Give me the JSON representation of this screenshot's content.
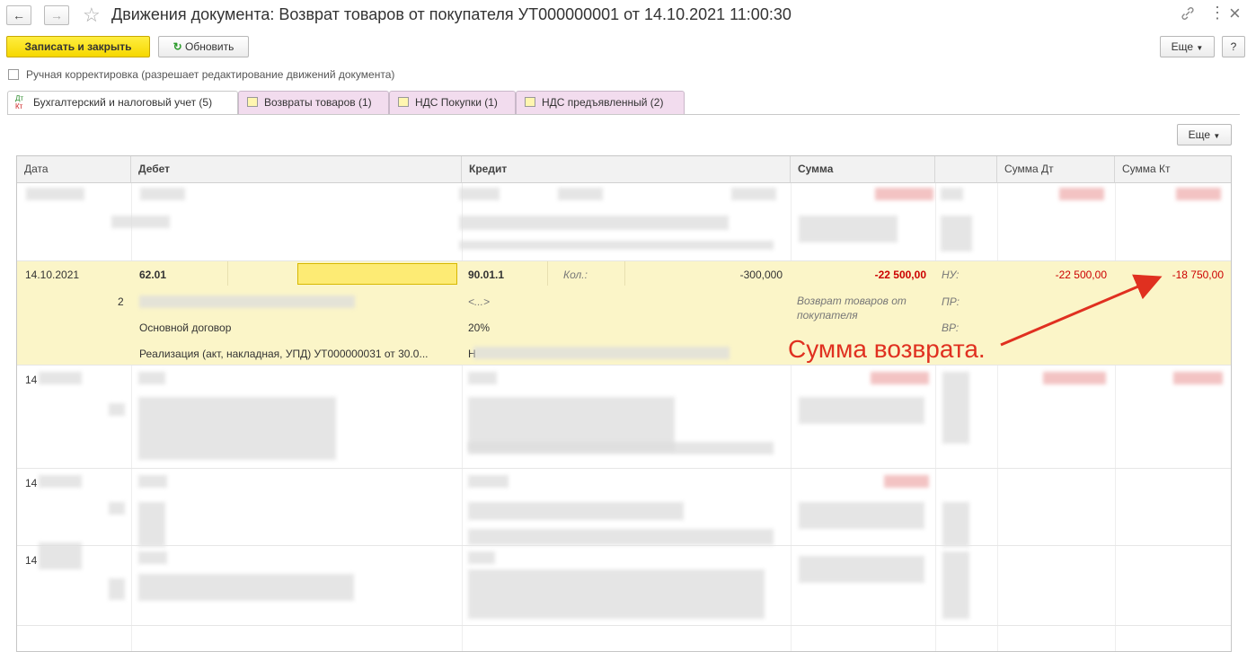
{
  "window": {
    "title": "Движения документа: Возврат товаров от покупателя УТ000000001 от 14.10.2021 11:00:30",
    "nav_back": "←",
    "nav_forward": "→",
    "star": "☆",
    "link_icon": "🔗",
    "menu_icon": "⋮",
    "close_icon": "×"
  },
  "toolbar": {
    "save_close": "Записать и закрыть",
    "refresh": "Обновить",
    "more": "Еще",
    "help": "?"
  },
  "manual_adjust": {
    "label": "Ручная корректировка (разрешает редактирование движений документа)",
    "checked": false
  },
  "tabs": [
    {
      "label": "Бухгалтерский и налоговый учет (5)",
      "icon": "dt-kt-icon",
      "active": true
    },
    {
      "label": "Возвраты товаров (1)",
      "icon": "register-icon",
      "active": false
    },
    {
      "label": "НДС Покупки (1)",
      "icon": "register-icon",
      "active": false
    },
    {
      "label": "НДС предъявленный (2)",
      "icon": "register-icon",
      "active": false
    }
  ],
  "tab_more": "Еще",
  "table": {
    "columns": [
      "Дата",
      "Дебет",
      "Кредит",
      "Сумма",
      "",
      "Сумма Дт",
      "Сумма Кт"
    ],
    "selected_row": {
      "date": "14.10.2021",
      "line_no": "2",
      "debit_account": "62.01",
      "debit_sub1": "Основной договор",
      "debit_sub2": "Реализация (акт, накладная, УПД) УТ000000031 от 30.0...",
      "credit_account": "90.01.1",
      "credit_qty_label": "Кол.:",
      "credit_qty": "-300,000",
      "credit_sub1": "<...>",
      "credit_sub2": "20%",
      "credit_sub3": "Н",
      "amount": "-22 500,00",
      "content": "Возврат товаров от покупателя",
      "nu_label": "НУ:",
      "pr_label": "ПР:",
      "vr_label": "ВР:",
      "amount_dt": "-22 500,00",
      "amount_kt": "-18 750,00"
    },
    "other_rows_date_prefix": [
      "14",
      "14",
      "14"
    ]
  },
  "annotation": {
    "text": "Сумма возврата.",
    "color": "#e03020"
  }
}
